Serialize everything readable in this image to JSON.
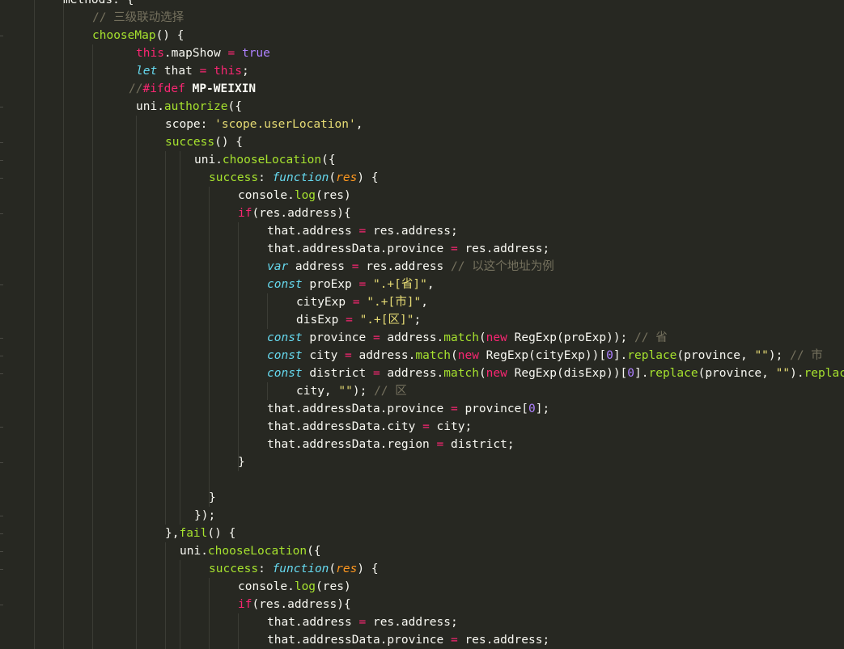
{
  "colors": {
    "background": "#272822",
    "text": "#f8f8f2",
    "comment": "#75715e",
    "keyword": "#f92672",
    "function": "#a6e22e",
    "string": "#e6db74",
    "storage_type": "#66d9ef",
    "parameter": "#fd971f",
    "number": "#ae81ff"
  },
  "code_lines": [
    {
      "indent": 78,
      "tokens": [
        [
          "methods: {",
          "plain"
        ]
      ]
    },
    {
      "indent": 114,
      "tokens": [
        [
          "// 三级联动选择",
          "cm"
        ]
      ]
    },
    {
      "indent": 114,
      "tokens": [
        [
          "chooseMap",
          "fn"
        ],
        [
          "() {",
          "plain"
        ]
      ]
    },
    {
      "indent": 168,
      "tokens": [
        [
          "this",
          "kw"
        ],
        [
          ".mapShow ",
          "plain"
        ],
        [
          "=",
          "kw"
        ],
        [
          " ",
          "plain"
        ],
        [
          "true",
          "bi"
        ]
      ]
    },
    {
      "indent": 168,
      "tokens": [
        [
          "let",
          "ty"
        ],
        [
          " that ",
          "plain"
        ],
        [
          "=",
          "kw"
        ],
        [
          " ",
          "plain"
        ],
        [
          "this",
          "kw"
        ],
        [
          ";",
          "plain"
        ]
      ]
    },
    {
      "indent": 159,
      "tokens": [
        [
          "//",
          "cm"
        ],
        [
          "#ifdef",
          "pre"
        ],
        [
          " MP-WEIXIN",
          "bold"
        ]
      ]
    },
    {
      "indent": 168,
      "tokens": [
        [
          "uni.",
          "plain"
        ],
        [
          "authorize",
          "fn"
        ],
        [
          "({",
          "plain"
        ]
      ]
    },
    {
      "indent": 204,
      "tokens": [
        [
          "scope: ",
          "plain"
        ],
        [
          "'scope.userLocation'",
          "str"
        ],
        [
          ",",
          "plain"
        ]
      ]
    },
    {
      "indent": 204,
      "tokens": [
        [
          "success",
          "fn"
        ],
        [
          "() {",
          "plain"
        ]
      ]
    },
    {
      "indent": 240,
      "tokens": [
        [
          "uni.",
          "plain"
        ],
        [
          "chooseLocation",
          "fn"
        ],
        [
          "({",
          "plain"
        ]
      ]
    },
    {
      "indent": 258,
      "tokens": [
        [
          "success",
          "fn"
        ],
        [
          ": ",
          "plain"
        ],
        [
          "function",
          "ty"
        ],
        [
          "(",
          "plain"
        ],
        [
          "res",
          "par"
        ],
        [
          ") {",
          "plain"
        ]
      ]
    },
    {
      "indent": 294,
      "tokens": [
        [
          "console.",
          "plain"
        ],
        [
          "log",
          "fn"
        ],
        [
          "(res)",
          "plain"
        ]
      ]
    },
    {
      "indent": 294,
      "tokens": [
        [
          "if",
          "kw"
        ],
        [
          "(res.address){",
          "plain"
        ]
      ]
    },
    {
      "indent": 330,
      "tokens": [
        [
          "that.address ",
          "plain"
        ],
        [
          "=",
          "kw"
        ],
        [
          " res.address;",
          "plain"
        ]
      ]
    },
    {
      "indent": 330,
      "tokens": [
        [
          "that.addressData.province ",
          "plain"
        ],
        [
          "=",
          "kw"
        ],
        [
          " res.address;",
          "plain"
        ]
      ]
    },
    {
      "indent": 330,
      "tokens": [
        [
          "var",
          "ty"
        ],
        [
          " address ",
          "plain"
        ],
        [
          "=",
          "kw"
        ],
        [
          " res.address ",
          "plain"
        ],
        [
          "// 以这个地址为例",
          "cm"
        ]
      ]
    },
    {
      "indent": 330,
      "tokens": [
        [
          "const",
          "ty"
        ],
        [
          " proExp ",
          "plain"
        ],
        [
          "=",
          "kw"
        ],
        [
          " ",
          "plain"
        ],
        [
          "\".+[省]\"",
          "str"
        ],
        [
          ",",
          "plain"
        ]
      ]
    },
    {
      "indent": 366,
      "tokens": [
        [
          "cityExp ",
          "plain"
        ],
        [
          "=",
          "kw"
        ],
        [
          " ",
          "plain"
        ],
        [
          "\".+[市]\"",
          "str"
        ],
        [
          ",",
          "plain"
        ]
      ]
    },
    {
      "indent": 366,
      "tokens": [
        [
          "disExp ",
          "plain"
        ],
        [
          "=",
          "kw"
        ],
        [
          " ",
          "plain"
        ],
        [
          "\".+[区]\"",
          "str"
        ],
        [
          ";",
          "plain"
        ]
      ]
    },
    {
      "indent": 330,
      "tokens": [
        [
          "const",
          "ty"
        ],
        [
          " province ",
          "plain"
        ],
        [
          "=",
          "kw"
        ],
        [
          " address.",
          "plain"
        ],
        [
          "match",
          "fn"
        ],
        [
          "(",
          "plain"
        ],
        [
          "new",
          "kw"
        ],
        [
          " RegExp(proExp)); ",
          "plain"
        ],
        [
          "// 省",
          "cm"
        ]
      ]
    },
    {
      "indent": 330,
      "tokens": [
        [
          "const",
          "ty"
        ],
        [
          " city ",
          "plain"
        ],
        [
          "=",
          "kw"
        ],
        [
          " address.",
          "plain"
        ],
        [
          "match",
          "fn"
        ],
        [
          "(",
          "plain"
        ],
        [
          "new",
          "kw"
        ],
        [
          " RegExp(cityExp))[",
          "plain"
        ],
        [
          "0",
          "bi"
        ],
        [
          "].",
          "plain"
        ],
        [
          "replace",
          "fn"
        ],
        [
          "(province, ",
          "plain"
        ],
        [
          "\"\"",
          "str"
        ],
        [
          "); ",
          "plain"
        ],
        [
          "// 市",
          "cm"
        ]
      ]
    },
    {
      "indent": 330,
      "tokens": [
        [
          "const",
          "ty"
        ],
        [
          " district ",
          "plain"
        ],
        [
          "=",
          "kw"
        ],
        [
          " address.",
          "plain"
        ],
        [
          "match",
          "fn"
        ],
        [
          "(",
          "plain"
        ],
        [
          "new",
          "kw"
        ],
        [
          " RegExp(disExp))[",
          "plain"
        ],
        [
          "0",
          "bi"
        ],
        [
          "].",
          "plain"
        ],
        [
          "replace",
          "fn"
        ],
        [
          "(province, ",
          "plain"
        ],
        [
          "\"\"",
          "str"
        ],
        [
          ").",
          "plain"
        ],
        [
          "replace",
          "fn"
        ],
        [
          "(",
          "plain"
        ]
      ]
    },
    {
      "indent": 366,
      "tokens": [
        [
          "city, ",
          "plain"
        ],
        [
          "\"\"",
          "str"
        ],
        [
          "); ",
          "plain"
        ],
        [
          "// 区",
          "cm"
        ]
      ]
    },
    {
      "indent": 330,
      "tokens": [
        [
          "that.addressData.province ",
          "plain"
        ],
        [
          "=",
          "kw"
        ],
        [
          " province[",
          "plain"
        ],
        [
          "0",
          "bi"
        ],
        [
          "];",
          "plain"
        ]
      ]
    },
    {
      "indent": 330,
      "tokens": [
        [
          "that.addressData.city ",
          "plain"
        ],
        [
          "=",
          "kw"
        ],
        [
          " city;",
          "plain"
        ]
      ]
    },
    {
      "indent": 330,
      "tokens": [
        [
          "that.addressData.region ",
          "plain"
        ],
        [
          "=",
          "kw"
        ],
        [
          " district;",
          "plain"
        ]
      ]
    },
    {
      "indent": 294,
      "tokens": [
        [
          "}",
          "plain"
        ]
      ]
    },
    {
      "indent": 0,
      "tokens": []
    },
    {
      "indent": 258,
      "tokens": [
        [
          "}",
          "plain"
        ]
      ]
    },
    {
      "indent": 240,
      "tokens": [
        [
          "});",
          "plain"
        ]
      ]
    },
    {
      "indent": 204,
      "tokens": [
        [
          "},",
          "plain"
        ],
        [
          "fail",
          "fn"
        ],
        [
          "() {",
          "plain"
        ]
      ]
    },
    {
      "indent": 222,
      "tokens": [
        [
          "uni.",
          "plain"
        ],
        [
          "chooseLocation",
          "fn"
        ],
        [
          "({",
          "plain"
        ]
      ]
    },
    {
      "indent": 258,
      "tokens": [
        [
          "success",
          "fn"
        ],
        [
          ": ",
          "plain"
        ],
        [
          "function",
          "ty"
        ],
        [
          "(",
          "plain"
        ],
        [
          "res",
          "par"
        ],
        [
          ") {",
          "plain"
        ]
      ]
    },
    {
      "indent": 294,
      "tokens": [
        [
          "console.",
          "plain"
        ],
        [
          "log",
          "fn"
        ],
        [
          "(res)",
          "plain"
        ]
      ]
    },
    {
      "indent": 294,
      "tokens": [
        [
          "if",
          "kw"
        ],
        [
          "(res.address){",
          "plain"
        ]
      ]
    },
    {
      "indent": 330,
      "tokens": [
        [
          "that.address ",
          "plain"
        ],
        [
          "=",
          "kw"
        ],
        [
          " res.address;",
          "plain"
        ]
      ]
    },
    {
      "indent": 330,
      "tokens": [
        [
          "that.addressData.province ",
          "plain"
        ],
        [
          "=",
          "kw"
        ],
        [
          " res.address;",
          "plain"
        ]
      ]
    }
  ]
}
